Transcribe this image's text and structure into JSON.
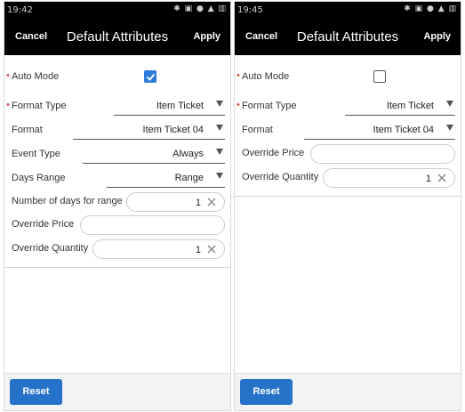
{
  "screens": [
    {
      "status": {
        "time": "19:42",
        "icons": "✱ ▣ ● ▲ ▥"
      },
      "appbar": {
        "cancel": "Cancel",
        "title": "Default Attributes",
        "apply": "Apply"
      },
      "fields": {
        "auto_mode": {
          "label": "Auto Mode",
          "checked": true
        },
        "format_type": {
          "label": "Format Type",
          "value": "Item Ticket"
        },
        "format": {
          "label": "Format",
          "value": "Item Ticket 04"
        },
        "event_type": {
          "label": "Event Type",
          "value": "Always"
        },
        "days_range": {
          "label": "Days Range",
          "value": "Range"
        },
        "days_for_range": {
          "label": "Number of days for range",
          "value": "1"
        },
        "override_price": {
          "label": "Override Price",
          "value": ""
        },
        "override_quantity": {
          "label": "Override Quantity",
          "value": "1"
        }
      },
      "reset_label": "Reset"
    },
    {
      "status": {
        "time": "19:45",
        "icons": "✱ ▣ ● ▲ ▥"
      },
      "appbar": {
        "cancel": "Cancel",
        "title": "Default Attributes",
        "apply": "Apply"
      },
      "fields": {
        "auto_mode": {
          "label": "Auto Mode",
          "checked": false
        },
        "format_type": {
          "label": "Format Type",
          "value": "Item Ticket"
        },
        "format": {
          "label": "Format",
          "value": "Item Ticket 04"
        },
        "override_price": {
          "label": "Override Price",
          "value": ""
        },
        "override_quantity": {
          "label": "Override Quantity",
          "value": "1"
        }
      },
      "reset_label": "Reset"
    }
  ],
  "colors": {
    "appbar_bg": "#000000",
    "accent": "#2f7bd8",
    "reset_button": "#2672c8",
    "required_marker": "#d9534f"
  }
}
